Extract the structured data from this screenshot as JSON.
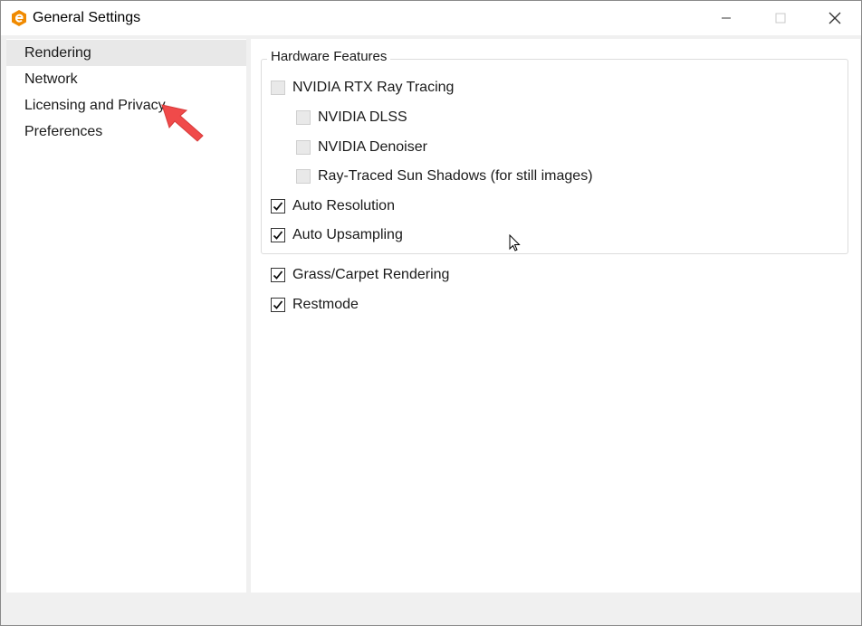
{
  "window": {
    "title": "General Settings",
    "icon": "app-logo-icon",
    "controls": [
      "minimize-icon",
      "maximize-icon",
      "close-icon"
    ]
  },
  "sidebar": {
    "items": [
      {
        "label": "Rendering",
        "selected": true
      },
      {
        "label": "Network",
        "selected": false
      },
      {
        "label": "Licensing and Privacy",
        "selected": false
      },
      {
        "label": "Preferences",
        "selected": false
      }
    ]
  },
  "content": {
    "group_title": "Hardware Features",
    "options": [
      {
        "label": "NVIDIA RTX Ray Tracing",
        "checked": false,
        "enabled": false
      },
      {
        "label": "NVIDIA DLSS",
        "checked": false,
        "enabled": false
      },
      {
        "label": "NVIDIA Denoiser",
        "checked": false,
        "enabled": false
      },
      {
        "label": "Ray-Traced Sun Shadows (for still images)",
        "checked": false,
        "enabled": false
      },
      {
        "label": "Auto Resolution",
        "checked": true,
        "enabled": true
      },
      {
        "label": "Auto Upsampling",
        "checked": true,
        "enabled": true
      }
    ],
    "extra_options": [
      {
        "label": "Grass/Carpet Rendering",
        "checked": true,
        "enabled": true
      },
      {
        "label": "Restmode",
        "checked": true,
        "enabled": true
      }
    ]
  },
  "colors": {
    "accent_logo": "#f08a00",
    "annotation_arrow": "#f04a4a",
    "selected_item_bg": "#e8e8e8"
  }
}
